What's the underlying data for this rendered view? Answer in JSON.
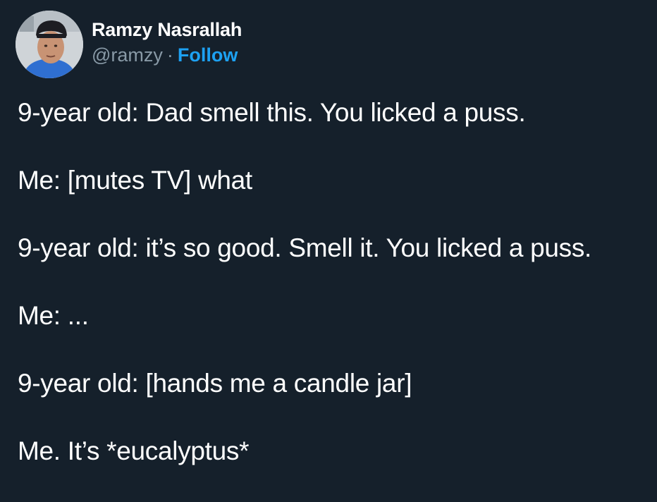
{
  "author": {
    "display_name": "Ramzy Nasrallah",
    "handle": "@ramzy",
    "separator": "·",
    "follow_label": "Follow"
  },
  "tweet": {
    "lines": [
      "9-year old: Dad smell this. You licked a puss.",
      "Me: [mutes TV] what",
      "9-year old: it’s so good. Smell it. You licked a puss.",
      "Me: ...",
      "9-year old: [hands me a candle jar]",
      "Me. It’s *eucalyptus*"
    ]
  },
  "colors": {
    "background": "#15202b",
    "text": "#ffffff",
    "muted": "#8899a6",
    "link": "#1da1f2"
  }
}
